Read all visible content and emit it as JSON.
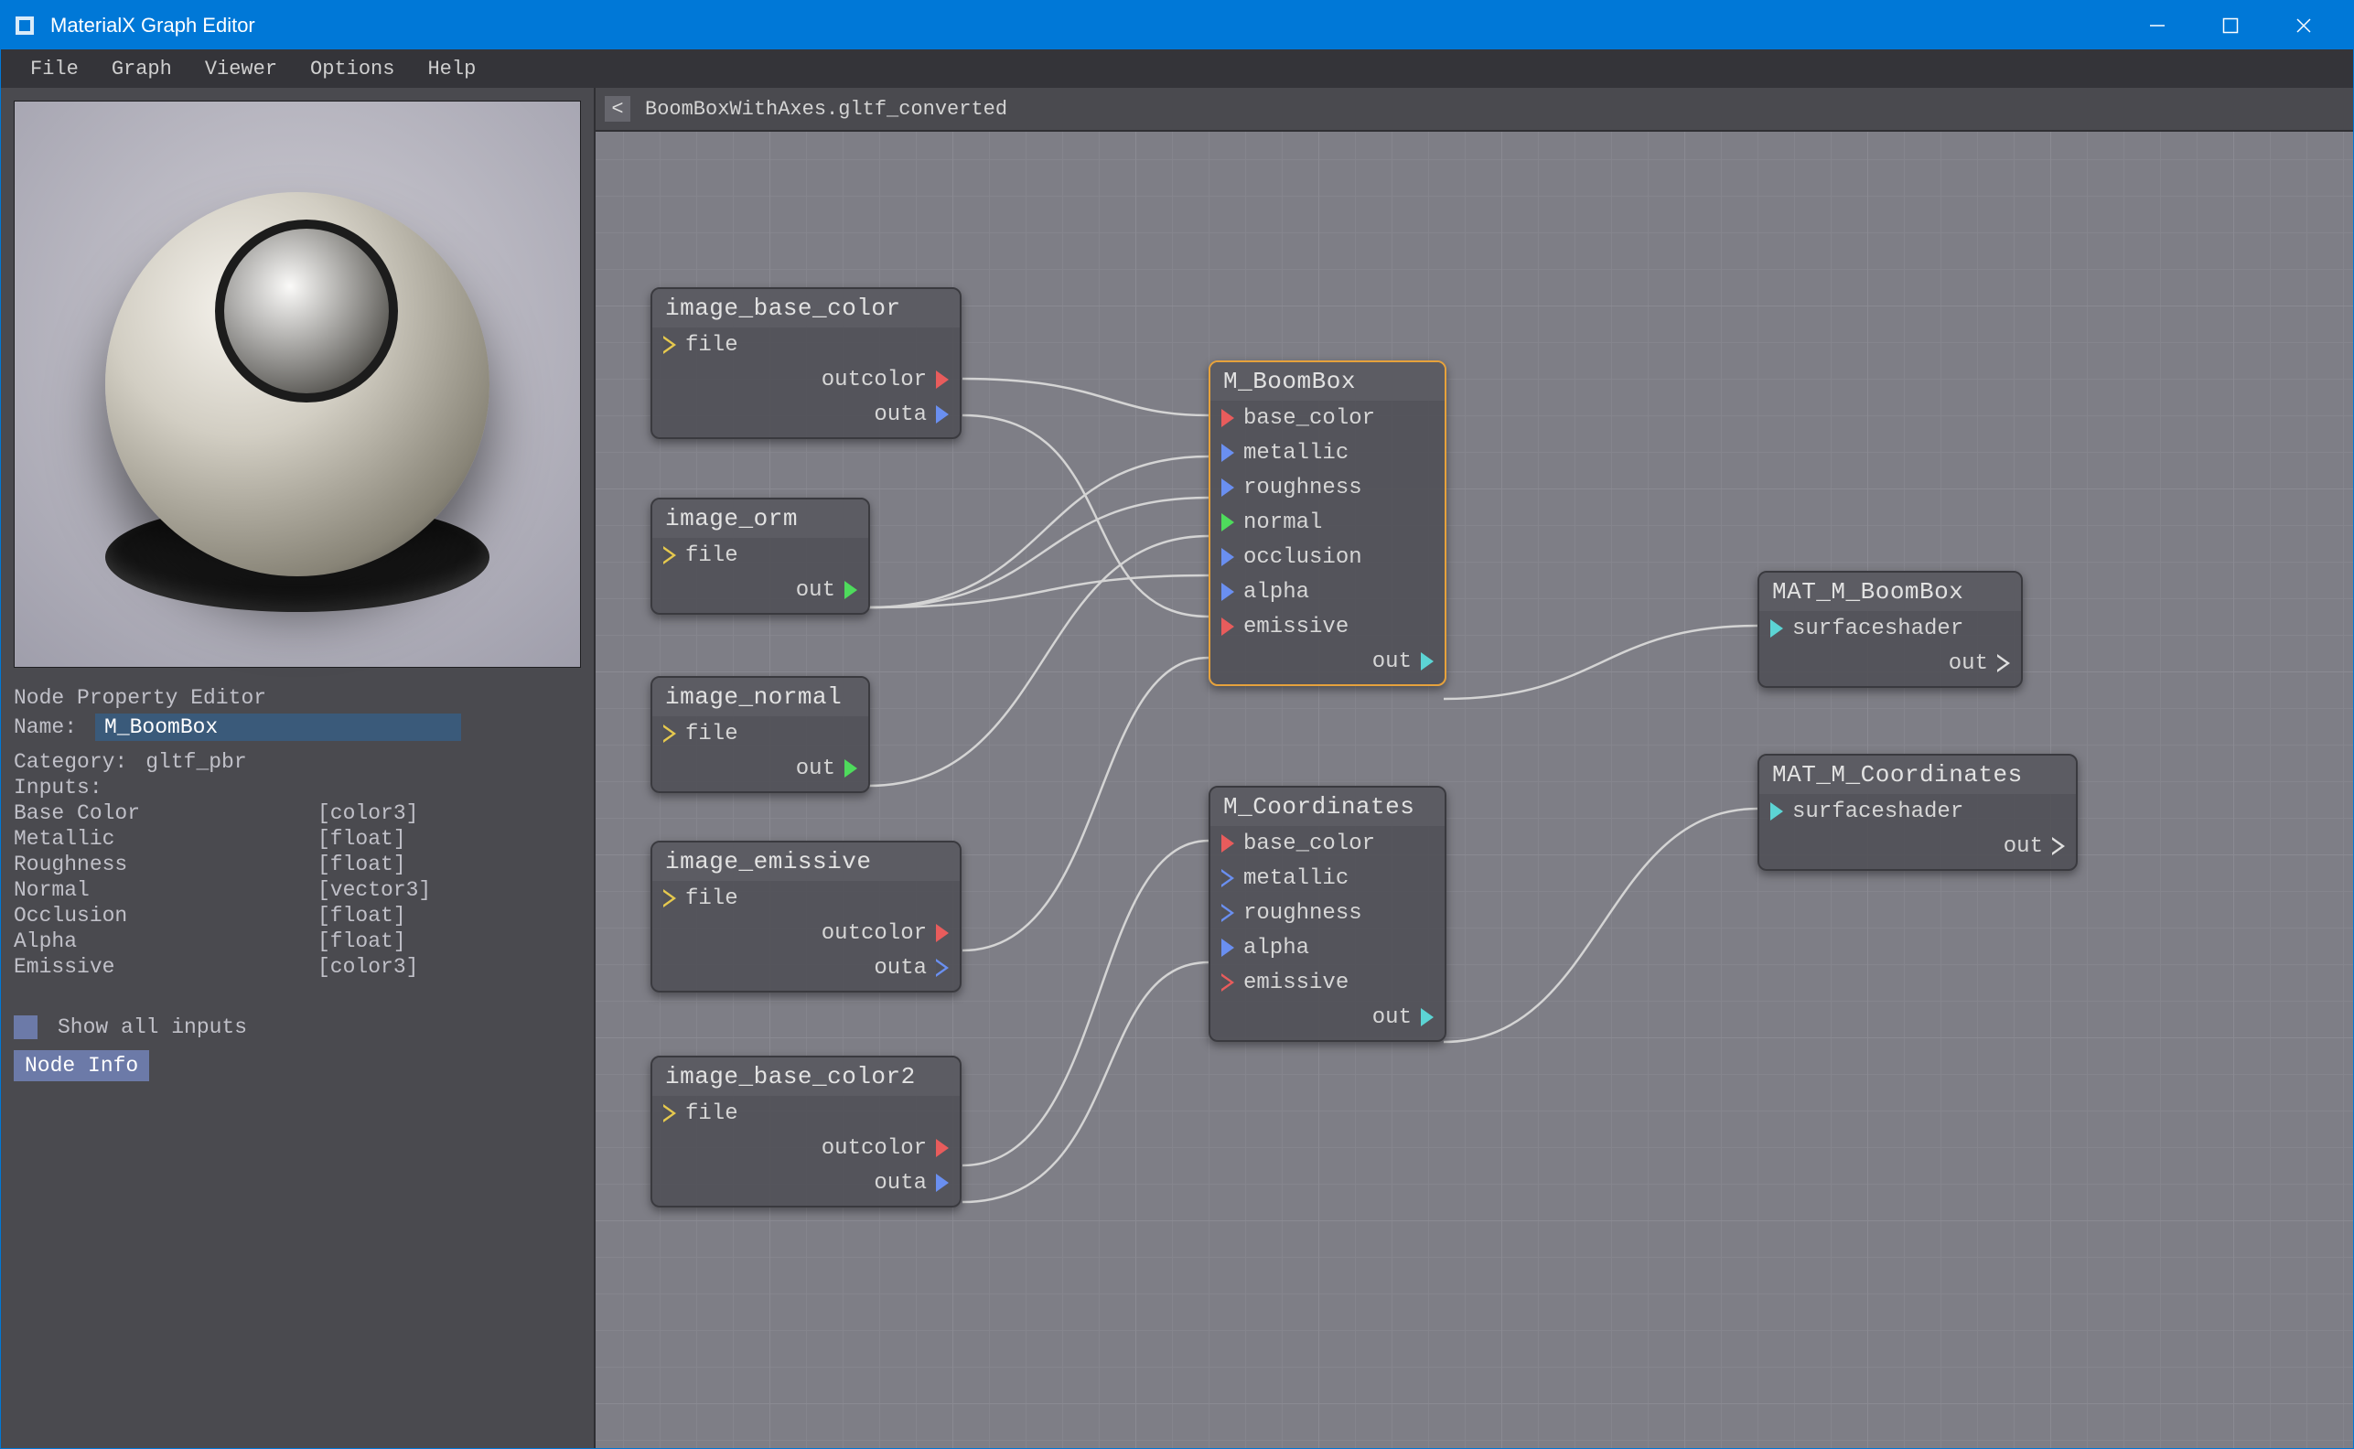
{
  "window": {
    "title": "MaterialX Graph Editor"
  },
  "menubar": [
    "File",
    "Graph",
    "Viewer",
    "Options",
    "Help"
  ],
  "graph": {
    "back_label": "<",
    "path": "BoomBoxWithAxes.gltf_converted"
  },
  "property_editor": {
    "header": "Node Property Editor",
    "name_label": "Name:",
    "name_value": "M_BoomBox",
    "category_label": "Category:",
    "category_value": "gltf_pbr",
    "inputs_label": "Inputs:",
    "inputs": [
      {
        "label": "Base Color",
        "type": "[color3]"
      },
      {
        "label": "Metallic",
        "type": "[float]"
      },
      {
        "label": "Roughness",
        "type": "[float]"
      },
      {
        "label": "Normal",
        "type": "[vector3]"
      },
      {
        "label": "Occlusion",
        "type": "[float]"
      },
      {
        "label": "Alpha",
        "type": "[float]"
      },
      {
        "label": "Emissive",
        "type": "[color3]"
      }
    ],
    "show_all_label": "Show all inputs",
    "node_info_label": "Node Info"
  },
  "nodes": {
    "image_base_color": {
      "title": "image_base_color",
      "inputs": [
        {
          "name": "file",
          "color": "yellow",
          "hollow": true
        }
      ],
      "outputs": [
        {
          "name": "outcolor",
          "color": "red"
        },
        {
          "name": "outa",
          "color": "blue"
        }
      ]
    },
    "image_orm": {
      "title": "image_orm",
      "inputs": [
        {
          "name": "file",
          "color": "yellow",
          "hollow": true
        }
      ],
      "outputs": [
        {
          "name": "out",
          "color": "green"
        }
      ]
    },
    "image_normal": {
      "title": "image_normal",
      "inputs": [
        {
          "name": "file",
          "color": "yellow",
          "hollow": true
        }
      ],
      "outputs": [
        {
          "name": "out",
          "color": "green"
        }
      ]
    },
    "image_emissive": {
      "title": "image_emissive",
      "inputs": [
        {
          "name": "file",
          "color": "yellow",
          "hollow": true
        }
      ],
      "outputs": [
        {
          "name": "outcolor",
          "color": "red"
        },
        {
          "name": "outa",
          "color": "blue",
          "hollow": true
        }
      ]
    },
    "image_base_color2": {
      "title": "image_base_color2",
      "inputs": [
        {
          "name": "file",
          "color": "yellow",
          "hollow": true
        }
      ],
      "outputs": [
        {
          "name": "outcolor",
          "color": "red"
        },
        {
          "name": "outa",
          "color": "blue"
        }
      ]
    },
    "m_boombox": {
      "title": "M_BoomBox",
      "inputs": [
        {
          "name": "base_color",
          "color": "red"
        },
        {
          "name": "metallic",
          "color": "blue"
        },
        {
          "name": "roughness",
          "color": "blue"
        },
        {
          "name": "normal",
          "color": "green"
        },
        {
          "name": "occlusion",
          "color": "blue"
        },
        {
          "name": "alpha",
          "color": "blue"
        },
        {
          "name": "emissive",
          "color": "red"
        }
      ],
      "outputs": [
        {
          "name": "out",
          "color": "cyan"
        }
      ]
    },
    "m_coordinates": {
      "title": "M_Coordinates",
      "inputs": [
        {
          "name": "base_color",
          "color": "red"
        },
        {
          "name": "metallic",
          "color": "blue",
          "hollow": true
        },
        {
          "name": "roughness",
          "color": "blue",
          "hollow": true
        },
        {
          "name": "alpha",
          "color": "blue"
        },
        {
          "name": "emissive",
          "color": "red",
          "hollow": true
        }
      ],
      "outputs": [
        {
          "name": "out",
          "color": "cyan"
        }
      ]
    },
    "mat_m_boombox": {
      "title": "MAT_M_BoomBox",
      "inputs": [
        {
          "name": "surfaceshader",
          "color": "cyan"
        }
      ],
      "outputs": [
        {
          "name": "out",
          "color": "white",
          "hollow": true
        }
      ]
    },
    "mat_m_coordinates": {
      "title": "MAT_M_Coordinates",
      "inputs": [
        {
          "name": "surfaceshader",
          "color": "cyan"
        }
      ],
      "outputs": [
        {
          "name": "out",
          "color": "white",
          "hollow": true
        }
      ]
    }
  }
}
